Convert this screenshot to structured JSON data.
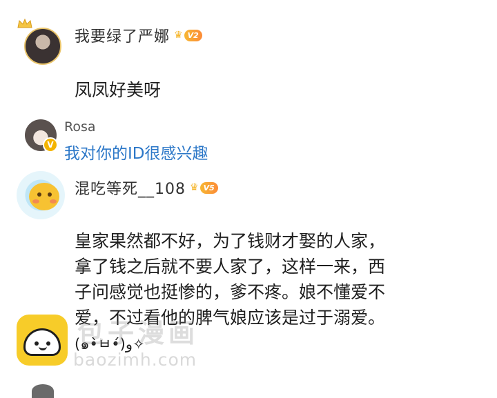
{
  "comments": [
    {
      "username": "我要绿了严娜",
      "vip_badge": "V2",
      "text": "凤凤好美呀"
    },
    {
      "username": "混吃等死__108",
      "vip_badge": "V5",
      "text_lines": [
        "皇家果然都不好，为了钱财才娶的人家，",
        "拿了钱之后就不要人家了，这样一来，西",
        "子问感觉也挺惨的，爹不疼。娘不懂爱不",
        "爱，不过看他的脾气娘应该是过于溺爱。",
        "(๑•̀ㅂ•́)و✧"
      ]
    }
  ],
  "reply": {
    "username": "Rosa",
    "text": "我对你的ID很感兴趣",
    "verified_badge": "V"
  },
  "watermark": {
    "title": "包子漫画",
    "url": "baozimh.com"
  },
  "icons": {
    "crown": "crown-icon",
    "vip": "vip-level-badge",
    "app": "baozi-app-icon"
  },
  "colors": {
    "reply_text": "#2d78c8",
    "vip_gradient_start": "#f7b733",
    "vip_gradient_end": "#fc8b37",
    "app_icon_bg": "#f7cc29"
  }
}
